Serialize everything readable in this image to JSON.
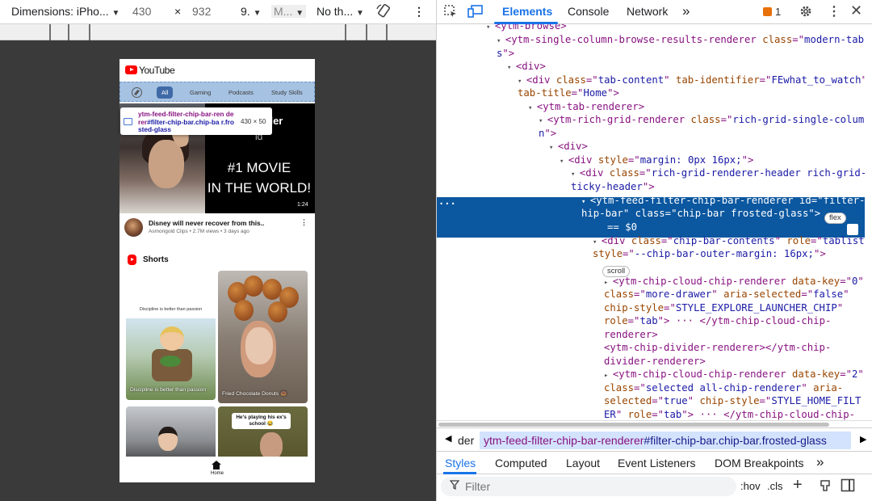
{
  "device_toolbar": {
    "dimensions_label": "Dimensions: iPho...",
    "width": "430",
    "times": "×",
    "height": "932",
    "zoom": "9.",
    "mode": "M...",
    "throttling": "No th...",
    "more": "⋮"
  },
  "phone": {
    "logo_text": "YouTube",
    "chips": [
      "All",
      "Gaming",
      "Podcasts",
      "Study Skills"
    ],
    "tooltip": {
      "tag": "ytm-feed-filter-chip-bar-ren derer",
      "selector": "#filter-chip-bar.chip-ba r.frosted-glass",
      "size": "430 × 50"
    },
    "hero": {
      "name": "nelzegler",
      "sub": "ld",
      "title_line1": "#1 MOVIE",
      "title_line2": "IN THE WORLD!",
      "duration": "1:24"
    },
    "video": {
      "title": "Disney will never recover from this..",
      "meta": "Asmongold Clips • 2.7M views • 3 days ago",
      "more": "⋮"
    },
    "shorts_title": "Shorts",
    "shorts": [
      {
        "caption": "Discipline is better than passion",
        "label": "Discipline is better than passion"
      },
      {
        "label": "Fried Chocolate Donuts 🍩"
      },
      {
        "label": ""
      },
      {
        "bubble": "He's playing his ex's school 😂"
      }
    ],
    "nav_home": "Home"
  },
  "devtools": {
    "tabs": [
      "Elements",
      "Console",
      "Network"
    ],
    "more_tabs": "»",
    "issues_count": "1",
    "dom_lines": [
      {
        "indent": 0,
        "tri": "▾",
        "parts": [
          [
            "tg",
            "<ytm-browse>"
          ]
        ]
      },
      {
        "indent": 1,
        "tri": "▾",
        "parts": [
          [
            "tg",
            "<ytm-single-column-browse-results-renderer "
          ],
          [
            "at",
            "class"
          ],
          [
            "tg",
            "=\""
          ],
          [
            "av",
            "modern-tab"
          ],
          [
            "tg",
            ""
          ]
        ]
      },
      {
        "indent": 1,
        "tri": "",
        "parts": [
          [
            "av",
            "s"
          ],
          [
            "tg",
            "\">"
          ]
        ]
      },
      {
        "indent": 2,
        "tri": "▾",
        "parts": [
          [
            "tg",
            "<div>"
          ]
        ]
      },
      {
        "indent": 3,
        "tri": "▾",
        "parts": [
          [
            "tg",
            "<div "
          ],
          [
            "at",
            "class"
          ],
          [
            "tg",
            "=\""
          ],
          [
            "av",
            "tab-content"
          ],
          [
            "tg",
            "\" "
          ],
          [
            "at",
            "tab-identifier"
          ],
          [
            "tg",
            "=\""
          ],
          [
            "av",
            "FEwhat_to_watch"
          ],
          [
            "tg",
            "\""
          ]
        ]
      },
      {
        "indent": 3,
        "tri": "",
        "parts": [
          [
            "at",
            "tab-title"
          ],
          [
            "tg",
            "=\""
          ],
          [
            "av",
            "Home"
          ],
          [
            "tg",
            "\">"
          ]
        ]
      },
      {
        "indent": 4,
        "tri": "▾",
        "parts": [
          [
            "tg",
            "<ytm-tab-renderer>"
          ]
        ]
      },
      {
        "indent": 5,
        "tri": "▾",
        "parts": [
          [
            "tg",
            "<ytm-rich-grid-renderer "
          ],
          [
            "at",
            "class"
          ],
          [
            "tg",
            "=\""
          ],
          [
            "av",
            "rich-grid-single-colum"
          ]
        ]
      },
      {
        "indent": 5,
        "tri": "",
        "parts": [
          [
            "av",
            "n"
          ],
          [
            "tg",
            "\">"
          ]
        ]
      },
      {
        "indent": 6,
        "tri": "▾",
        "parts": [
          [
            "tg",
            "<div>"
          ]
        ]
      },
      {
        "indent": 7,
        "tri": "▾",
        "parts": [
          [
            "tg",
            "<div "
          ],
          [
            "at",
            "style"
          ],
          [
            "tg",
            "=\""
          ],
          [
            "av",
            "margin: 0px 16px;"
          ],
          [
            "tg",
            "\">"
          ]
        ]
      },
      {
        "indent": 8,
        "tri": "▾",
        "parts": [
          [
            "tg",
            "<div "
          ],
          [
            "at",
            "class"
          ],
          [
            "tg",
            "=\""
          ],
          [
            "av",
            "rich-grid-renderer-header rich-grid-s"
          ]
        ]
      },
      {
        "indent": 8,
        "tri": "",
        "parts": [
          [
            "av",
            "ticky-header"
          ],
          [
            "tg",
            "\">"
          ]
        ]
      },
      {
        "indent": 9,
        "tri": "▾",
        "parts": [
          [
            "tg",
            "<ytm-feed-filter-chip-bar-renderer "
          ],
          [
            "at",
            "id"
          ],
          [
            "tg",
            "=\""
          ],
          [
            "av",
            "filter-c"
          ]
        ]
      },
      {
        "indent": 9,
        "tri": "",
        "parts": [
          [
            "av",
            "hip-bar"
          ],
          [
            "tg",
            "\" "
          ],
          [
            "at",
            "class"
          ],
          [
            "tg",
            "=\""
          ],
          [
            "av",
            "chip-bar frosted-glass"
          ],
          [
            "tg",
            "\">"
          ]
        ]
      },
      {
        "indent": 9,
        "tri": "",
        "parts": [
          [
            "tg",
            "== $0"
          ]
        ]
      },
      {
        "indent": 10,
        "tri": "▾",
        "parts": [
          [
            "tg",
            "<div "
          ],
          [
            "at",
            "class"
          ],
          [
            "tg",
            "=\""
          ],
          [
            "av",
            "chip-bar-contents"
          ],
          [
            "tg",
            "\" "
          ],
          [
            "at",
            "role"
          ],
          [
            "tg",
            "=\""
          ],
          [
            "av",
            "tablist"
          ],
          [
            "tg",
            "\""
          ]
        ]
      },
      {
        "indent": 10,
        "tri": "",
        "parts": [
          [
            "at",
            "style"
          ],
          [
            "tg",
            "=\""
          ],
          [
            "av",
            "--chip-bar-outer-margin: 16px;"
          ],
          [
            "tg",
            "\">"
          ]
        ]
      },
      {
        "indent": 10,
        "tri": "",
        "parts": []
      },
      {
        "indent": 11,
        "tri": "▸",
        "parts": [
          [
            "tg",
            "<ytm-chip-cloud-chip-renderer "
          ],
          [
            "at",
            "data-key"
          ],
          [
            "tg",
            "=\""
          ],
          [
            "av",
            "0"
          ],
          [
            "tg",
            "\""
          ]
        ]
      },
      {
        "indent": 11,
        "tri": "",
        "parts": [
          [
            "at",
            "class"
          ],
          [
            "tg",
            "=\""
          ],
          [
            "av",
            "more-drawer"
          ],
          [
            "tg",
            "\" "
          ],
          [
            "at",
            "aria-selected"
          ],
          [
            "tg",
            "=\""
          ],
          [
            "av",
            "false"
          ],
          [
            "tg",
            "\""
          ]
        ]
      },
      {
        "indent": 11,
        "tri": "",
        "parts": [
          [
            "at",
            "chip-style"
          ],
          [
            "tg",
            "=\""
          ],
          [
            "av",
            "STYLE_EXPLORE_LAUNCHER_CHIP"
          ],
          [
            "tg",
            "\""
          ]
        ]
      },
      {
        "indent": 11,
        "tri": "",
        "parts": [
          [
            "at",
            "role"
          ],
          [
            "tg",
            "=\""
          ],
          [
            "av",
            "tab"
          ],
          [
            "tg",
            "\">"
          ],
          [
            "tg",
            " ··· "
          ],
          [
            "tg",
            "</ytm-chip-cloud-chip-"
          ]
        ]
      },
      {
        "indent": 11,
        "tri": "",
        "parts": [
          [
            "tg",
            "renderer>"
          ]
        ]
      },
      {
        "indent": 11,
        "tri": "",
        "parts": [
          [
            "tg",
            "<ytm-chip-divider-renderer></ytm-chip-"
          ]
        ]
      },
      {
        "indent": 11,
        "tri": "",
        "parts": [
          [
            "tg",
            "divider-renderer>"
          ]
        ]
      },
      {
        "indent": 11,
        "tri": "▸",
        "parts": [
          [
            "tg",
            "<ytm-chip-cloud-chip-renderer "
          ],
          [
            "at",
            "data-key"
          ],
          [
            "tg",
            "=\""
          ],
          [
            "av",
            "2"
          ],
          [
            "tg",
            "\""
          ]
        ]
      },
      {
        "indent": 11,
        "tri": "",
        "parts": [
          [
            "at",
            "class"
          ],
          [
            "tg",
            "=\""
          ],
          [
            "av",
            "selected all-chip-renderer"
          ],
          [
            "tg",
            "\" "
          ],
          [
            "at",
            "aria-"
          ]
        ]
      },
      {
        "indent": 11,
        "tri": "",
        "parts": [
          [
            "at",
            "selected"
          ],
          [
            "tg",
            "=\""
          ],
          [
            "av",
            "true"
          ],
          [
            "tg",
            "\" "
          ],
          [
            "at",
            "chip-style"
          ],
          [
            "tg",
            "=\""
          ],
          [
            "av",
            "STYLE_HOME_FILT"
          ]
        ]
      },
      {
        "indent": 11,
        "tri": "",
        "parts": [
          [
            "av",
            "ER"
          ],
          [
            "tg",
            "\" "
          ],
          [
            "at",
            "role"
          ],
          [
            "tg",
            "=\""
          ],
          [
            "av",
            "tab"
          ],
          [
            "tg",
            "\">"
          ],
          [
            "tg",
            " ··· "
          ],
          [
            "tg",
            "</ytm-chip-cloud-chip-"
          ]
        ]
      }
    ],
    "badge_flex": "flex",
    "badge_scroll": "scroll",
    "breadcrumb_prefix": "der",
    "breadcrumb_tag": "ytm-feed-filter-chip-bar-renderer",
    "breadcrumb_rest": "#filter-chip-bar.chip-bar.frosted-glass",
    "subtabs": [
      "Styles",
      "Computed",
      "Layout",
      "Event Listeners",
      "DOM Breakpoints"
    ],
    "filter_placeholder": "Filter",
    "hov": ":hov",
    "cls": ".cls"
  }
}
